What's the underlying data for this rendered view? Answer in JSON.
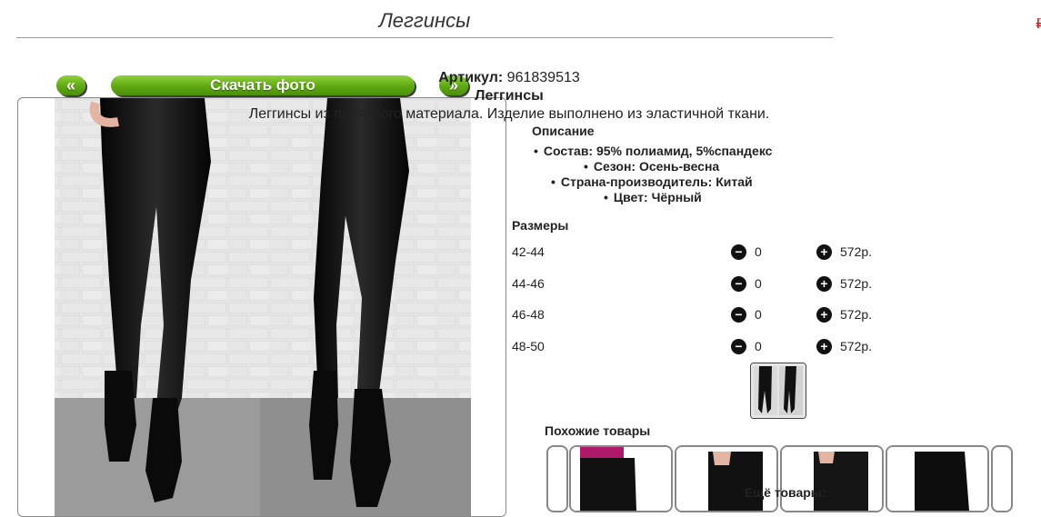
{
  "page": {
    "title": "Леггинсы"
  },
  "gallery": {
    "prev_label": "«",
    "download_label": "Скачать фото",
    "next_label": "»"
  },
  "product": {
    "article_label": "Артикул:",
    "article_value": "961839513",
    "name": "Леггинсы",
    "description": "Леггинсы из приятного материала. Изделие выполнено из эластичной ткани.",
    "description_heading": "Описание",
    "attributes": [
      "Состав: 95% полиамид, 5%спандекс",
      "Сезон: Осень-весна",
      "Страна-производитель: Китай",
      "Цвет: Чёрный"
    ]
  },
  "sizes": {
    "heading": "Размеры",
    "rows": [
      {
        "size": "42-44",
        "qty": "0",
        "price": "572р."
      },
      {
        "size": "44-46",
        "qty": "0",
        "price": "572р."
      },
      {
        "size": "46-48",
        "qty": "0",
        "price": "572р."
      },
      {
        "size": "48-50",
        "qty": "0",
        "price": "572р."
      }
    ],
    "minus_icon": "minus-circle-icon",
    "plus_icon": "plus-circle-icon"
  },
  "related": {
    "similar_heading": "Похожие товары",
    "more_label": "Ещё товары:"
  },
  "colors": {
    "accent_green": "#5ea912",
    "brick": "#e9e9e9",
    "garment": "#111111"
  }
}
